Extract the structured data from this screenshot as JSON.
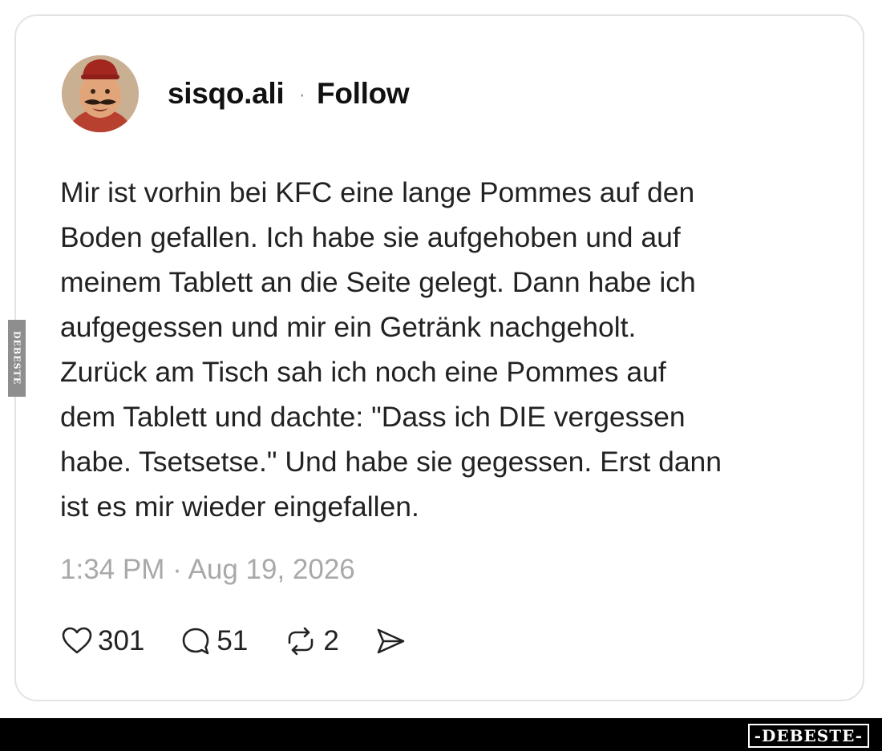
{
  "post": {
    "username": "sisqo.ali",
    "separator": "·",
    "follow_label": "Follow",
    "text_lines": [
      "Mir ist vorhin bei KFC eine lange Pommes auf den",
      "Boden gefallen. Ich habe sie aufgehoben und auf",
      "meinem Tablett an die Seite gelegt. Dann habe ich",
      "aufgegessen und mir ein Getränk nachgeholt.",
      "Zurück am Tisch sah ich noch eine Pommes auf",
      "dem Tablett und dachte: \"Dass ich DIE vergessen",
      "habe. Tsetsetse.\" Und habe sie gegessen. Erst dann",
      "ist es mir wieder eingefallen."
    ],
    "timestamp": "1:34 PM · Aug 19, 2026",
    "actions": {
      "like_icon": "heart-icon",
      "like_count": "301",
      "reply_icon": "speech-bubble-icon",
      "reply_count": "51",
      "repost_icon": "repost-icon",
      "repost_count": "2",
      "share_icon": "send-icon"
    }
  },
  "watermark": {
    "side_text": "DEBESTE",
    "footer_text": "-DEBESTE-"
  },
  "colors": {
    "text": "#222222",
    "muted": "#a9a9a9",
    "card_border": "#e3e3e3",
    "footer_bg": "#000000"
  }
}
